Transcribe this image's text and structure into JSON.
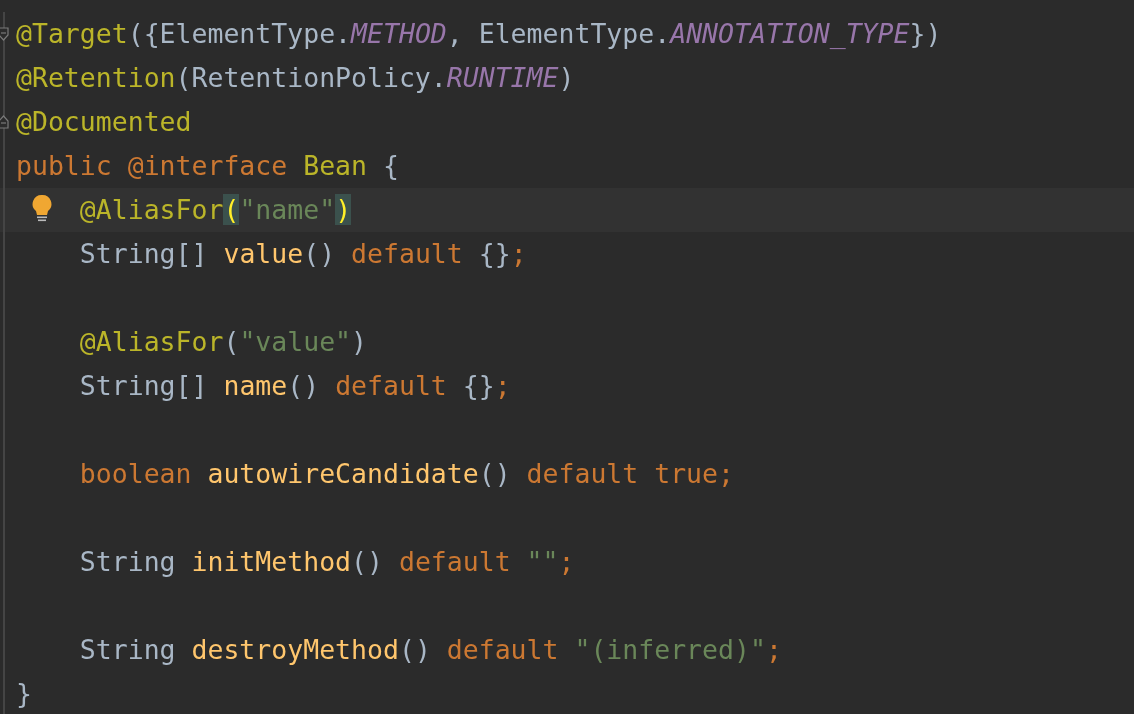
{
  "editor": {
    "lines": [
      {
        "kind": "code",
        "fold": {
          "kind": "start"
        },
        "tokens": [
          {
            "text": "@Target",
            "kind": "annotation"
          },
          {
            "text": "({ElementType.",
            "kind": "plain"
          },
          {
            "text": "METHOD",
            "kind": "constant"
          },
          {
            "text": ", ElementType.",
            "kind": "plain"
          },
          {
            "text": "ANNOTATION_TYPE",
            "kind": "constant"
          },
          {
            "text": "})",
            "kind": "plain"
          }
        ]
      },
      {
        "kind": "code",
        "tokens": [
          {
            "text": "@Retention",
            "kind": "annotation"
          },
          {
            "text": "(RetentionPolicy.",
            "kind": "plain"
          },
          {
            "text": "RUNTIME",
            "kind": "constant"
          },
          {
            "text": ")",
            "kind": "plain"
          }
        ]
      },
      {
        "kind": "code",
        "fold": {
          "kind": "end"
        },
        "tokens": [
          {
            "text": "@Documented",
            "kind": "annotation"
          }
        ]
      },
      {
        "kind": "code",
        "tokens": [
          {
            "text": "public @interface ",
            "kind": "keyword"
          },
          {
            "text": "Bean",
            "kind": "annotation"
          },
          {
            "text": " {",
            "kind": "plain"
          }
        ]
      },
      {
        "kind": "caret-line",
        "bulb": true,
        "tokens": [
          {
            "text": "    @AliasFor",
            "kind": "annotation"
          },
          {
            "text": "(",
            "kind": "brace-match"
          },
          {
            "text": "\"name\"",
            "kind": "string"
          },
          {
            "text": ")",
            "kind": "brace-match"
          }
        ]
      },
      {
        "kind": "code",
        "tokens": [
          {
            "text": "    String[] ",
            "kind": "plain"
          },
          {
            "text": "value",
            "kind": "method"
          },
          {
            "text": "() ",
            "kind": "plain"
          },
          {
            "text": "default ",
            "kind": "keyword"
          },
          {
            "text": "{}",
            "kind": "plain"
          },
          {
            "text": ";",
            "kind": "keyword"
          }
        ]
      },
      {
        "kind": "blank"
      },
      {
        "kind": "code",
        "tokens": [
          {
            "text": "    @AliasFor",
            "kind": "annotation"
          },
          {
            "text": "(",
            "kind": "plain"
          },
          {
            "text": "\"value\"",
            "kind": "string"
          },
          {
            "text": ")",
            "kind": "plain"
          }
        ]
      },
      {
        "kind": "code",
        "tokens": [
          {
            "text": "    String[] ",
            "kind": "plain"
          },
          {
            "text": "name",
            "kind": "method"
          },
          {
            "text": "() ",
            "kind": "plain"
          },
          {
            "text": "default ",
            "kind": "keyword"
          },
          {
            "text": "{}",
            "kind": "plain"
          },
          {
            "text": ";",
            "kind": "keyword"
          }
        ]
      },
      {
        "kind": "blank"
      },
      {
        "kind": "code",
        "tokens": [
          {
            "text": "    boolean ",
            "kind": "keyword"
          },
          {
            "text": "autowireCandidate",
            "kind": "method"
          },
          {
            "text": "() ",
            "kind": "plain"
          },
          {
            "text": "default true;",
            "kind": "keyword"
          }
        ]
      },
      {
        "kind": "blank"
      },
      {
        "kind": "code",
        "tokens": [
          {
            "text": "    String ",
            "kind": "plain"
          },
          {
            "text": "initMethod",
            "kind": "method"
          },
          {
            "text": "() ",
            "kind": "plain"
          },
          {
            "text": "default ",
            "kind": "keyword"
          },
          {
            "text": "\"\"",
            "kind": "string"
          },
          {
            "text": ";",
            "kind": "keyword"
          }
        ]
      },
      {
        "kind": "blank"
      },
      {
        "kind": "code",
        "tokens": [
          {
            "text": "    String ",
            "kind": "plain"
          },
          {
            "text": "destroyMethod",
            "kind": "method"
          },
          {
            "text": "() ",
            "kind": "plain"
          },
          {
            "text": "default ",
            "kind": "keyword"
          },
          {
            "text": "\"(inferred)\"",
            "kind": "string"
          },
          {
            "text": ";",
            "kind": "keyword"
          }
        ]
      },
      {
        "kind": "code",
        "tokens": [
          {
            "text": "}",
            "kind": "plain"
          }
        ]
      }
    ]
  }
}
